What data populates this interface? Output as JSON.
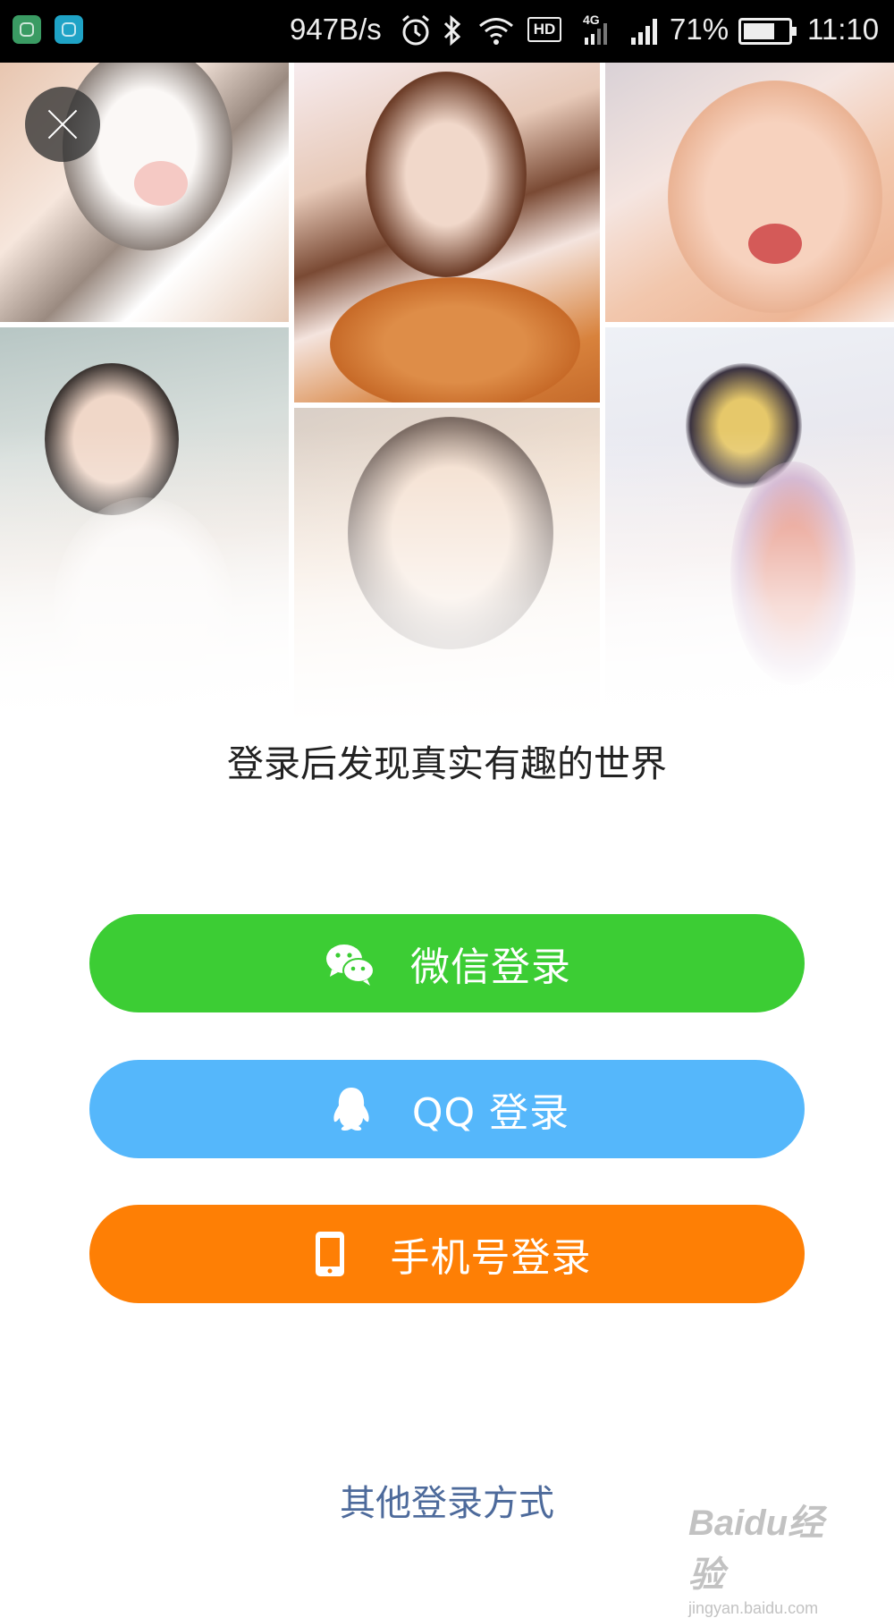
{
  "status_bar": {
    "net_speed": "947B/s",
    "signal_type": "4G",
    "hd": "HD",
    "battery_percent": "71%",
    "battery_level": 0.71,
    "time": "11:10"
  },
  "tagline": "登录后发现真实有趣的世界",
  "buttons": {
    "wechat_label": "微信登录",
    "qq_label": "QQ 登录",
    "phone_label": "手机号登录"
  },
  "other_login": "其他登录方式",
  "watermark": {
    "logo": "Baidu经验",
    "url": "jingyan.baidu.com"
  },
  "colors": {
    "wechat": "#3ccd34",
    "qq": "#55b7fb",
    "phone": "#fe7f05",
    "link": "#4d6a9b"
  },
  "icons": {
    "close": "close-icon",
    "wechat": "wechat-icon",
    "qq": "qq-penguin-icon",
    "phone": "phone-icon"
  }
}
